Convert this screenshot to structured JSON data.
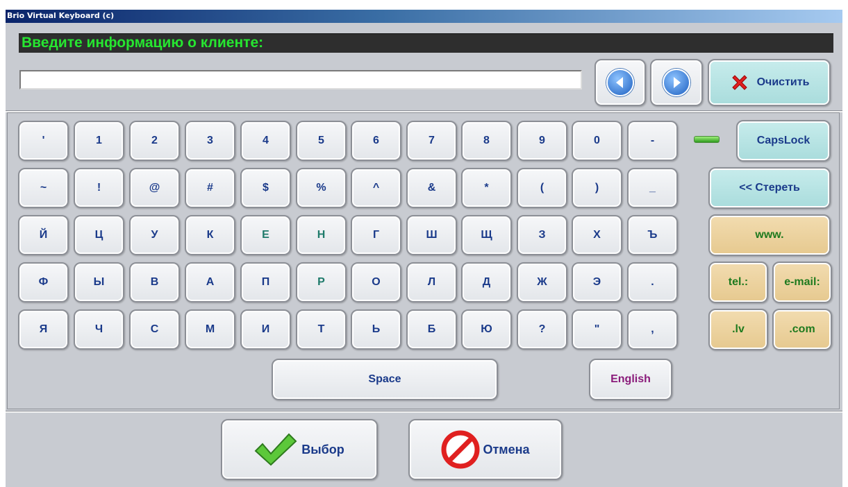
{
  "window": {
    "title": "Brio Virtual Keyboard (c)"
  },
  "prompt": "Введите информацию о клиенте:",
  "input": {
    "value": ""
  },
  "top_buttons": {
    "clear": "Очистить"
  },
  "rows": [
    [
      "'",
      "1",
      "2",
      "3",
      "4",
      "5",
      "6",
      "7",
      "8",
      "9",
      "0",
      "-"
    ],
    [
      "~",
      "!",
      "@",
      "#",
      "$",
      "%",
      "^",
      "&",
      "*",
      "(",
      ")",
      "_"
    ],
    [
      "Й",
      "Ц",
      "У",
      "К",
      "Е",
      "Н",
      "Г",
      "Ш",
      "Щ",
      "З",
      "Х",
      "Ъ"
    ],
    [
      "Ф",
      "Ы",
      "В",
      "А",
      "П",
      "Р",
      "О",
      "Л",
      "Д",
      "Ж",
      "Э",
      "."
    ],
    [
      "Я",
      "Ч",
      "С",
      "М",
      "И",
      "Т",
      "Ь",
      "Б",
      "Ю",
      "?",
      "\"",
      ","
    ]
  ],
  "side": {
    "capslock": "CapsLock",
    "backspace": "<< Стереть",
    "www": "www.",
    "tel": "tel.:",
    "email": "e-mail:",
    "lv": ".lv",
    "com": ".com"
  },
  "space": "Space",
  "lang": "English",
  "bottom": {
    "ok": "Выбор",
    "cancel": "Отмена"
  },
  "colors": {
    "prompt_text": "#26e630",
    "key_text": "#1a3a8a",
    "teal_key": "#bfe6e6",
    "tan_key": "#ecd39f"
  }
}
